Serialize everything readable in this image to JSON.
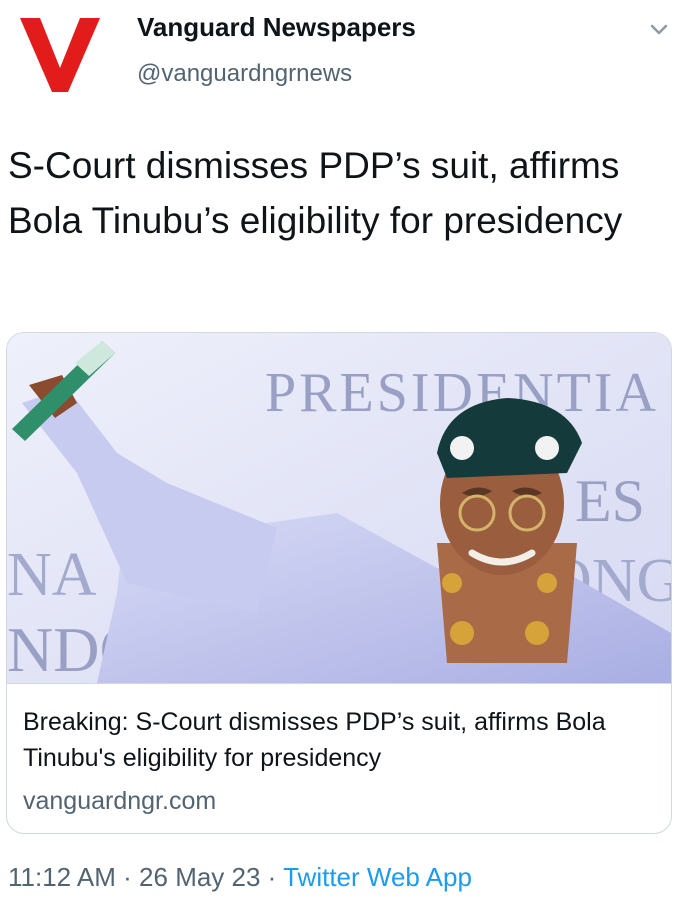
{
  "account": {
    "display_name": "Vanguard Newspapers",
    "handle": "@vanguardngrnews",
    "logo_letter": "V",
    "logo_color": "#e21b1b"
  },
  "tweet": {
    "text": "S-Court dismisses PDP’s suit, affirms Bola Tinubu’s eligibility for presidency"
  },
  "card": {
    "image_caption_text": "PRESIDENTIA",
    "title": "Breaking: S-Court dismisses PDP’s suit, affirms Bola Tinubu's eligibility for presidency",
    "domain": "vanguardngr.com"
  },
  "meta": {
    "time": "11:12 AM",
    "separator": " · ",
    "date": "26 May 23",
    "app": "Twitter Web App"
  },
  "colors": {
    "link": "#1d9bf0",
    "secondary_text": "#536471",
    "border": "#cfd9de"
  }
}
